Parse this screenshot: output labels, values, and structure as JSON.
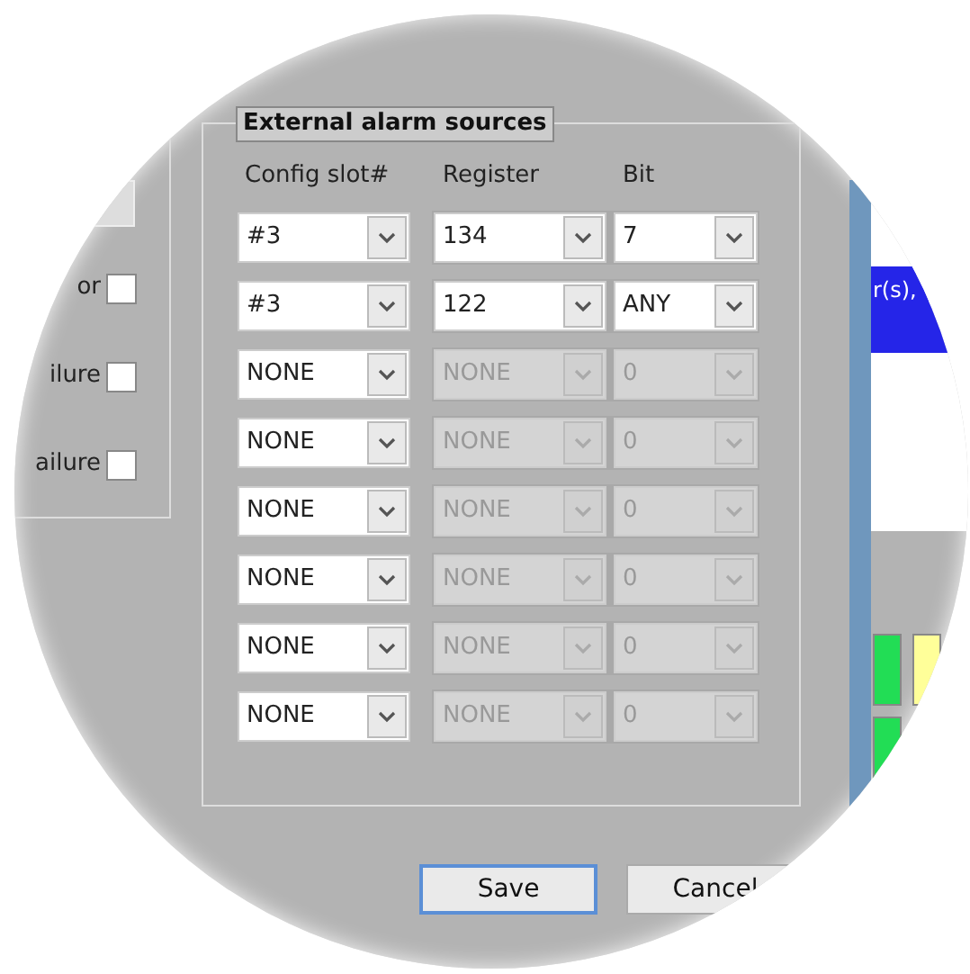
{
  "left_panel": {
    "checkboxes": [
      {
        "label": "or",
        "checked": false
      },
      {
        "label": "ilure",
        "checked": false
      },
      {
        "label": "ailure",
        "checked": false
      }
    ]
  },
  "external_alarm_sources": {
    "title": "External alarm sources",
    "columns": [
      "Config slot#",
      "Register",
      "Bit"
    ],
    "rows": [
      {
        "config_slot": "#3",
        "register": "134",
        "bit": "7",
        "disabled": false
      },
      {
        "config_slot": "#3",
        "register": "122",
        "bit": "ANY",
        "disabled": false
      },
      {
        "config_slot": "NONE",
        "register": "NONE",
        "bit": "0",
        "disabled": true
      },
      {
        "config_slot": "NONE",
        "register": "NONE",
        "bit": "0",
        "disabled": true
      },
      {
        "config_slot": "NONE",
        "register": "NONE",
        "bit": "0",
        "disabled": true
      },
      {
        "config_slot": "NONE",
        "register": "NONE",
        "bit": "0",
        "disabled": true
      },
      {
        "config_slot": "NONE",
        "register": "NONE",
        "bit": "0",
        "disabled": true
      },
      {
        "config_slot": "NONE",
        "register": "NONE",
        "bit": "0",
        "disabled": true
      }
    ]
  },
  "right_panel": {
    "highlight_text": "r(s),",
    "status_cells": [
      {
        "color": "#22dd55"
      },
      {
        "color": "#ffff99"
      },
      {
        "color": "#22dd55"
      }
    ]
  },
  "buttons": [
    {
      "label": "Save",
      "default": true
    },
    {
      "label": "Cancel",
      "default": false
    }
  ]
}
